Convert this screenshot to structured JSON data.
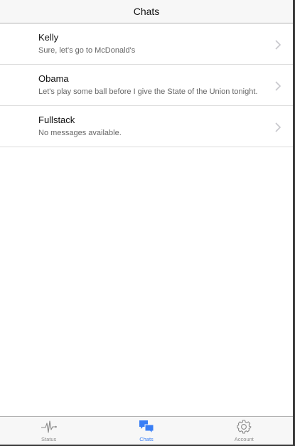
{
  "header": {
    "title": "Chats"
  },
  "chats": [
    {
      "name": "Kelly",
      "message": "Sure, let's go to McDonald's"
    },
    {
      "name": "Obama",
      "message": "Let's play some ball before I give the State of the Union tonight."
    },
    {
      "name": "Fullstack",
      "message": "No messages available."
    }
  ],
  "tabs": [
    {
      "label": "Status",
      "icon": "pulse-icon",
      "active": false
    },
    {
      "label": "Chats",
      "icon": "chatbubbles-icon",
      "active": true
    },
    {
      "label": "Account",
      "icon": "gear-icon",
      "active": false
    }
  ],
  "colors": {
    "accent": "#387ef5",
    "inactive": "#8a8a8a"
  }
}
